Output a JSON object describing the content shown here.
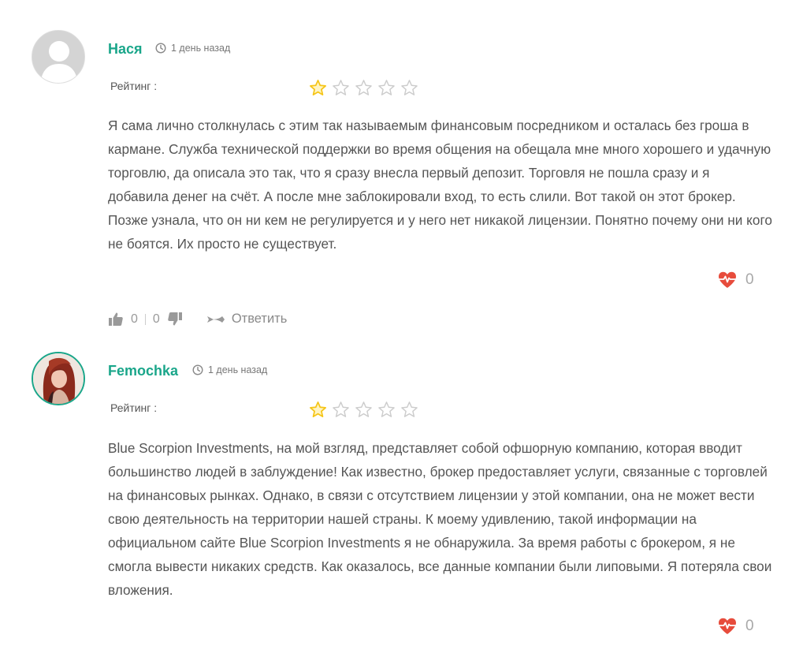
{
  "comments": [
    {
      "author": "Нася",
      "time": "1 день назад",
      "rating_label": "Рейтинг :",
      "rating": 1,
      "rating_max": 5,
      "text": "Я сама лично столкнулась с этим так называемым финансовым посредником и осталась без гроша в кармане. Служба технической поддержки во время общения на обещала мне много хорошего и удачную торговлю, да описала это так, что я сразу внесла первый депозит. Торговля не пошла сразу и я добавила денег на счёт. А после мне заблокировали вход, то есть слили. Вот такой он этот брокер. Позже узнала, что он ни кем не регулируется и у него нет никакой лицензии. Понятно почему они ни кого не боятся. Их просто не существует.",
      "likes": "0",
      "upvotes": "0",
      "downvotes": "0",
      "reply_label": "Ответить"
    },
    {
      "author": "Femochka",
      "time": "1 день назад",
      "rating_label": "Рейтинг :",
      "rating": 1,
      "rating_max": 5,
      "text": "Blue Scorpion Investments, на мой взгляд, представляет собой офшорную компанию, которая вводит большинство людей в заблуждение! Как известно, брокер предоставляет услуги, связанные с торговлей на финансовых рынках. Однако, в связи с отсутствием лицензии у этой компании, она не может вести свою деятельность на территории нашей страны. К моему удивлению, такой информации на официальном сайте Blue Scorpion Investments я не обнаружила. За время работы с брокером, я не смогла вывести никаких средств. Как оказалось, все данные компании были липовыми. Я потеряла свои вложения.",
      "likes": "0"
    }
  ],
  "colors": {
    "accent": "#1aa68a",
    "star_filled": "#f5c518",
    "star_empty": "#cccccc",
    "heart": "#e74c3c"
  }
}
